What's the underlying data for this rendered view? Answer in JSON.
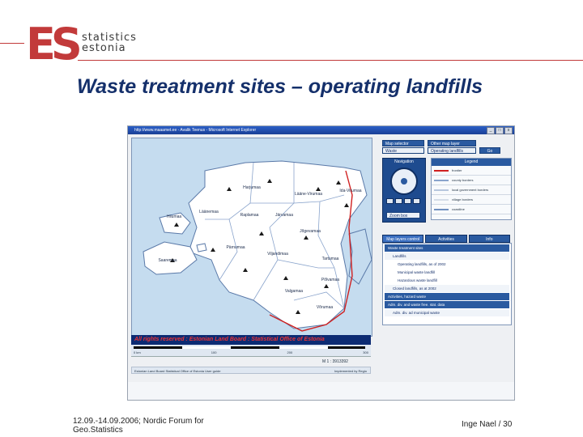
{
  "logo": {
    "mark": "ES",
    "line1": "statistics",
    "line2": "estonia"
  },
  "slide": {
    "title": "Waste treatment sites – operating landfills"
  },
  "window": {
    "title": "http://www.maaamet.ee - Avalik Teenus - Microsoft Internet Explorer",
    "buttons": [
      "_",
      "□",
      "x"
    ]
  },
  "map": {
    "banner": "All rights reserved : Estonian Land Board : Statistical Office of Estonia",
    "scale_labels": [
      "0 km",
      "100",
      "200",
      "300"
    ],
    "ratio": "M 1 : 3913392",
    "footer_left": "Estonian Land Board   Statistical Office of Estonia   User guide",
    "footer_right": "Implemented by Regio",
    "counties": [
      {
        "name": "Harjumaa"
      },
      {
        "name": "Lääne-Virumaa"
      },
      {
        "name": "Ida-Virumaa"
      },
      {
        "name": "Läänemaa"
      },
      {
        "name": "Raplamaa"
      },
      {
        "name": "Järvamaa"
      },
      {
        "name": "Jõgevamaa"
      },
      {
        "name": "Hiiumaa"
      },
      {
        "name": "Pärnumaa"
      },
      {
        "name": "Viljandimaa"
      },
      {
        "name": "Tartumaa"
      },
      {
        "name": "Põlvamaa"
      },
      {
        "name": "Saaremaa"
      },
      {
        "name": "Valgamaa"
      },
      {
        "name": "Võrumaa"
      }
    ]
  },
  "panel": {
    "map_selector_label": "Map selector",
    "map_selector_value": "Waste",
    "map_layer_label": "Other map layer",
    "map_layer_value": "Operating landfills",
    "go_button": "Go",
    "navigation_title": "Navigation",
    "zoom_button": "Zoom box",
    "legend_title": "Legend",
    "legend_items": [
      {
        "label": "frontier",
        "color": "#d02020"
      },
      {
        "label": "county borders",
        "color": "#8aa4cc"
      },
      {
        "label": "local government borders",
        "color": "#b7c6dd"
      },
      {
        "label": "village borders",
        "color": "#d5dde8"
      },
      {
        "label": "coastline",
        "color": "#6f8fbf"
      }
    ],
    "tabs": [
      "Map layers control",
      "Activities",
      "Info"
    ],
    "layers": [
      {
        "label": "Waste treatment sites",
        "level": 0
      },
      {
        "label": "Landfills",
        "level": 1
      },
      {
        "label": "Operating landfills, as of 2002",
        "level": 2
      },
      {
        "label": "Municipal waste landfill",
        "level": 2
      },
      {
        "label": "Hazardous waste landfill",
        "level": 2
      },
      {
        "label": "Closed landfills, as at 2002",
        "level": 1
      },
      {
        "label": "Activities, hazard waste",
        "level": 0
      },
      {
        "label": "Adm. div. and waste free. stat. data",
        "level": 0
      },
      {
        "label": "Adm. div. ad municipal waste",
        "level": 1
      }
    ]
  },
  "footer": {
    "left": "12.09.-14.09.2006; Nordic Forum for Geo.Statistics",
    "right": "Inge Nael / 30"
  }
}
